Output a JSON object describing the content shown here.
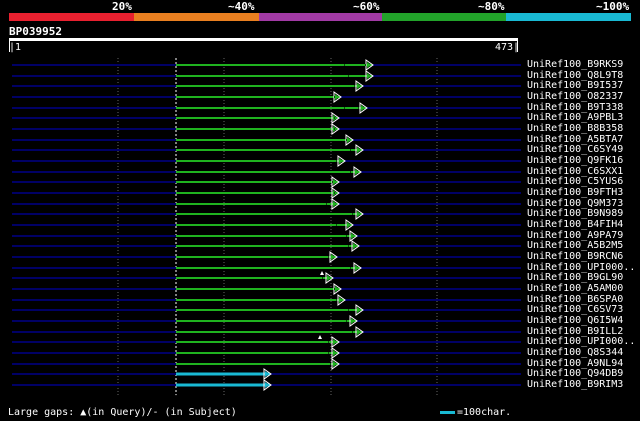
{
  "scale": {
    "labels": [
      "20%",
      "~40%",
      "~60%",
      "~80%",
      "~100%"
    ],
    "band_colors": [
      "#e8202f",
      "#e97f20",
      "#a23aa5",
      "#22a32a",
      "#19b9d3"
    ]
  },
  "query": {
    "id": "BP039952",
    "start": "|1",
    "end": "473|",
    "length": 473
  },
  "colors": {
    "hit": "#1fb31f",
    "short_hit": "#19b9d3",
    "row_line": "#000066",
    "grid": "#666666"
  },
  "hits": [
    {
      "label": "UniRef100_B9RKS9",
      "start": 0,
      "end": 196,
      "color": "green",
      "mark": [
        168,
        189
      ]
    },
    {
      "label": "UniRef100_Q8L9T8",
      "start": 0,
      "end": 196,
      "color": "green",
      "mark": [
        172
      ]
    },
    {
      "label": "UniRef100_B9I537",
      "start": 0,
      "end": 186,
      "color": "green",
      "mark": [
        178
      ]
    },
    {
      "label": "UniRef100_O82337",
      "start": 0,
      "end": 164,
      "color": "green",
      "mark": [
        158
      ]
    },
    {
      "label": "UniRef100_B9T338",
      "start": 0,
      "end": 190,
      "color": "green",
      "mark": [
        168,
        182
      ]
    },
    {
      "label": "UniRef100_A9PBL3",
      "start": 0,
      "end": 162,
      "color": "green",
      "mark": [
        158
      ]
    },
    {
      "label": "UniRef100_B8B358",
      "start": 0,
      "end": 162,
      "color": "green",
      "mark": [
        158
      ]
    },
    {
      "label": "UniRef100_A5BTA7",
      "start": 0,
      "end": 176,
      "color": "green",
      "mark": [
        170
      ]
    },
    {
      "label": "UniRef100_C6SY49",
      "start": 0,
      "end": 186,
      "color": "green",
      "mark": [
        174
      ]
    },
    {
      "label": "UniRef100_Q9FK16",
      "start": 0,
      "end": 168,
      "color": "green",
      "mark": [
        160
      ]
    },
    {
      "label": "UniRef100_C6SXX1",
      "start": 0,
      "end": 184,
      "color": "green",
      "mark": [
        174
      ]
    },
    {
      "label": "UniRef100_C5YUS6",
      "start": 0,
      "end": 162,
      "color": "green",
      "mark": [
        156
      ]
    },
    {
      "label": "UniRef100_B9FTH3",
      "start": 0,
      "end": 162,
      "color": "green",
      "mark": [
        158
      ]
    },
    {
      "label": "UniRef100_Q9M373",
      "start": 0,
      "end": 162,
      "color": "green",
      "mark": [
        150
      ]
    },
    {
      "label": "UniRef100_B9N989",
      "start": 0,
      "end": 186,
      "color": "green",
      "mark": [
        176
      ]
    },
    {
      "label": "UniRef100_B4FIH4",
      "start": 0,
      "end": 176,
      "color": "green",
      "mark": [
        160
      ]
    },
    {
      "label": "UniRef100_A9PA79",
      "start": 0,
      "end": 180,
      "color": "green",
      "mark": [
        170
      ]
    },
    {
      "label": "UniRef100_A5B2M5",
      "start": 0,
      "end": 182,
      "color": "green",
      "mark": [
        172
      ]
    },
    {
      "label": "UniRef100_B9RCN6",
      "start": 0,
      "end": 160,
      "color": "green",
      "mark": [
        152
      ]
    },
    {
      "label": "UniRef100_UPI000..",
      "start": 0,
      "end": 184,
      "color": "green",
      "mark": [
        174
      ]
    },
    {
      "label": "UniRef100_B9GL90",
      "start": 0,
      "end": 156,
      "color": "green",
      "mark": [
        146
      ],
      "gap": 146
    },
    {
      "label": "UniRef100_A5AM00",
      "start": 0,
      "end": 164,
      "color": "green",
      "mark": [
        158
      ]
    },
    {
      "label": "UniRef100_B6SPA0",
      "start": 0,
      "end": 168,
      "color": "green",
      "mark": [
        160
      ]
    },
    {
      "label": "UniRef100_C6SV73",
      "start": 0,
      "end": 186,
      "color": "green",
      "mark": [
        172
      ]
    },
    {
      "label": "UniRef100_Q6I5W4",
      "start": 0,
      "end": 180,
      "color": "green",
      "mark": [
        170
      ]
    },
    {
      "label": "UniRef100_B9ILL2",
      "start": 0,
      "end": 186,
      "color": "green",
      "mark": [
        176
      ]
    },
    {
      "label": "UniRef100_UPI000..",
      "start": 0,
      "end": 162,
      "color": "green",
      "mark": [
        152
      ],
      "gap": 144
    },
    {
      "label": "UniRef100_Q8S344",
      "start": 0,
      "end": 162,
      "color": "green",
      "mark": [
        152
      ]
    },
    {
      "label": "UniRef100_A9NL94",
      "start": 0,
      "end": 162,
      "color": "green",
      "mark": [
        154
      ]
    },
    {
      "label": "UniRef100_Q94DB9",
      "start": 0,
      "end": 94,
      "color": "cyan"
    },
    {
      "label": "UniRef100_B9RIM3",
      "start": 0,
      "end": 94,
      "color": "cyan"
    }
  ],
  "footer": {
    "gaps_text": "Large gaps: ▲(in Query)/- (in Subject)",
    "legend_text": "=100char."
  }
}
